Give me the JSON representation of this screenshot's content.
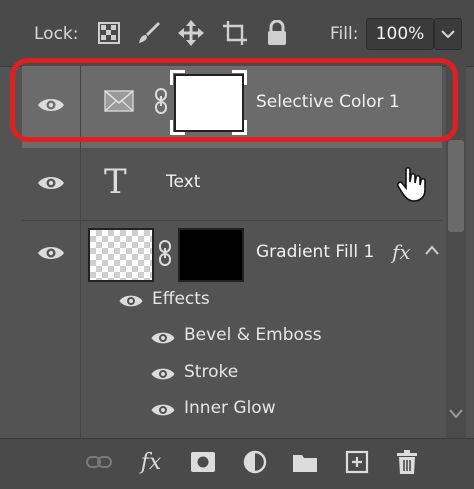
{
  "lockbar": {
    "lock_label": "Lock:",
    "fill_label": "Fill:",
    "fill_value": "100%"
  },
  "layers": [
    {
      "name": "Selective Color 1",
      "selected": true
    },
    {
      "name": "Text",
      "selected": false
    },
    {
      "name": "Gradient Fill 1",
      "selected": false,
      "fx_badge": "fx"
    }
  ],
  "effects": {
    "header": "Effects",
    "items": [
      "Bevel & Emboss",
      "Stroke",
      "Inner Glow"
    ]
  },
  "bottombar": {
    "fx_label": "fx"
  },
  "colors": {
    "selection_outline": "#e02020",
    "selected_row": "#6b6b6b",
    "panel": "#535353"
  }
}
